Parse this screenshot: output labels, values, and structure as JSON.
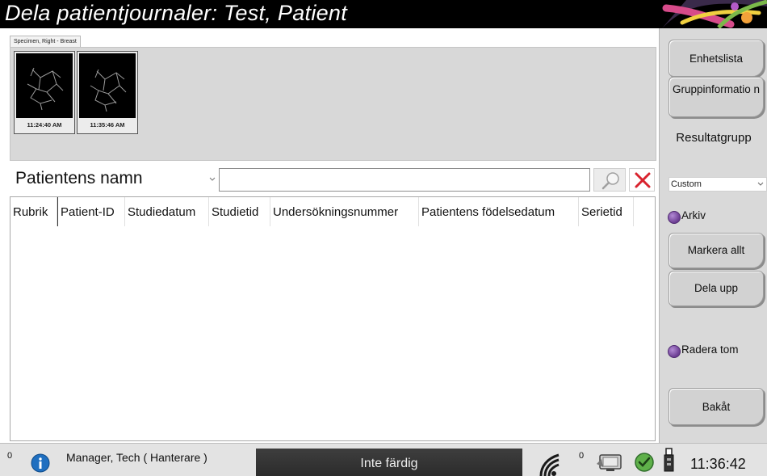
{
  "window": {
    "title": "Dela patientjournaler: Test, Patient"
  },
  "specimen": {
    "tab_label": "Specimen, Right - Breast",
    "thumbnails": [
      {
        "time": "11:24:40 AM"
      },
      {
        "time": "11:35:46 AM"
      }
    ]
  },
  "search": {
    "field_label": "Patientens namn",
    "input_value": ""
  },
  "table": {
    "columns": [
      "Rubrik",
      "Patient-ID",
      "Studiedatum",
      "Studietid",
      "Undersökningsnummer",
      "Patientens födelsedatum",
      "Serietid"
    ],
    "rows": []
  },
  "right_panel": {
    "device_list_label": "Enhetslista",
    "group_info_label": "Gruppinformatio n",
    "result_group_label": "Resultatgrupp",
    "result_group_value": "Custom",
    "archive_label": "Arkiv",
    "select_all_label": "Markera allt",
    "split_label": "Dela upp",
    "delete_empty_label": "Radera tom",
    "back_label": "Bakåt"
  },
  "status_bar": {
    "left_count": "0",
    "user": "Manager, Tech ( Hanterare )",
    "status": "Inte färdig",
    "right_count": "0",
    "clock": "11:36:42"
  },
  "colors": {
    "title_bg": "#000000",
    "panel_bg": "#d9d9d9",
    "radio_purple": "#7b4aa3",
    "close_red": "#d9232e",
    "status_bg": "#333333"
  },
  "icons": [
    "search-icon",
    "close-icon",
    "chevron-down-icon",
    "info-icon",
    "wifi-icon",
    "monitor-icon",
    "check-icon",
    "usb-icon"
  ]
}
